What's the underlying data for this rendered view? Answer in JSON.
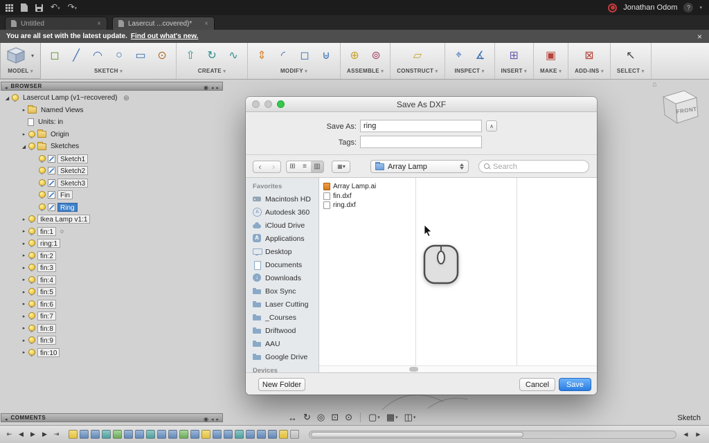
{
  "titlebar": {
    "user": "Jonathan Odom"
  },
  "tabs": [
    {
      "label": "Untitled",
      "active": false
    },
    {
      "label": "Lasercut ...covered)*",
      "active": true
    }
  ],
  "notification": {
    "message": "You are all set with the latest update.",
    "link": "Find out what's new.",
    "close": "×"
  },
  "ribbon": {
    "groups": [
      {
        "label": "MODEL",
        "model": true,
        "icons": [
          "model-cube"
        ]
      },
      {
        "label": "SKETCH",
        "icons": [
          "create-sketch",
          "sketch-line",
          "sketch-arc",
          "sketch-circle",
          "sketch-rect",
          "sketch-offset"
        ]
      },
      {
        "label": "CREATE",
        "icons": [
          "extrude",
          "revolve",
          "sweep"
        ]
      },
      {
        "label": "MODIFY",
        "icons": [
          "press-pull",
          "fillet",
          "shell",
          "combine"
        ]
      },
      {
        "label": "ASSEMBLE",
        "icons": [
          "new-component",
          "joint"
        ]
      },
      {
        "label": "CONSTRUCT",
        "icons": [
          "construct-plane"
        ]
      },
      {
        "label": "INSPECT",
        "icons": [
          "measure",
          "section-analysis"
        ]
      },
      {
        "label": "INSERT",
        "icons": [
          "insert-mesh"
        ]
      },
      {
        "label": "MAKE",
        "icons": [
          "make-3d-print"
        ]
      },
      {
        "label": "ADD-INS",
        "icons": [
          "scripts-addins"
        ]
      },
      {
        "label": "SELECT",
        "icons": [
          "select-cursor"
        ]
      }
    ]
  },
  "browser": {
    "title": "BROWSER",
    "rows": [
      {
        "label": "Lasercut Lamp (v1~recovered)",
        "indent": 0,
        "arrow": "open",
        "bulb": true,
        "trailing": "target"
      },
      {
        "label": "Named Views",
        "indent": 1,
        "arrow": "closed",
        "folder": true
      },
      {
        "label": "Units: in",
        "indent": 1,
        "doc": true
      },
      {
        "label": "Origin",
        "indent": 1,
        "arrow": "closed",
        "bulb": true,
        "folder": true
      },
      {
        "label": "Sketches",
        "indent": 1,
        "arrow": "open",
        "bulb": true,
        "folder": true
      },
      {
        "label": "Sketch1",
        "indent": 2,
        "bulb": true,
        "sketch": true,
        "chip": true
      },
      {
        "label": "Sketch2",
        "indent": 2,
        "bulb": true,
        "sketch": true,
        "chip": true
      },
      {
        "label": "Sketch3",
        "indent": 2,
        "bulb": true,
        "sketch": true,
        "chip": true
      },
      {
        "label": "Fin",
        "indent": 2,
        "bulb": true,
        "sketch": true,
        "chip": true
      },
      {
        "label": "Ring",
        "indent": 2,
        "bulb": true,
        "sketch": true,
        "chip": true,
        "selected": true
      },
      {
        "label": "Ikea Lamp v1:1",
        "indent": 1,
        "arrow": "closed",
        "bulb": true,
        "chip": true
      },
      {
        "label": "fin:1",
        "indent": 1,
        "arrow": "closed",
        "bulb": true,
        "chip": true,
        "trailing": "circle"
      },
      {
        "label": "ring:1",
        "indent": 1,
        "arrow": "closed",
        "bulb": true,
        "chip": true
      },
      {
        "label": "fin:2",
        "indent": 1,
        "arrow": "closed",
        "bulb": true,
        "chip": true
      },
      {
        "label": "fin:3",
        "indent": 1,
        "arrow": "closed",
        "bulb": true,
        "chip": true
      },
      {
        "label": "fin:4",
        "indent": 1,
        "arrow": "closed",
        "bulb": true,
        "chip": true
      },
      {
        "label": "fin:5",
        "indent": 1,
        "arrow": "closed",
        "bulb": true,
        "chip": true
      },
      {
        "label": "fin:6",
        "indent": 1,
        "arrow": "closed",
        "bulb": true,
        "chip": true
      },
      {
        "label": "fin:7",
        "indent": 1,
        "arrow": "closed",
        "bulb": true,
        "chip": true
      },
      {
        "label": "fin:8",
        "indent": 1,
        "arrow": "closed",
        "bulb": true,
        "chip": true
      },
      {
        "label": "fin:9",
        "indent": 1,
        "arrow": "closed",
        "bulb": true,
        "chip": true
      },
      {
        "label": "fin:10",
        "indent": 1,
        "arrow": "closed",
        "bulb": true,
        "chip": true
      }
    ]
  },
  "viewcube": {
    "face": "FRONT"
  },
  "dialog": {
    "title": "Save As DXF",
    "save_as_label": "Save As:",
    "save_as_value": "ring",
    "tags_label": "Tags:",
    "tags_value": "",
    "location_value": "Array Lamp",
    "search_placeholder": "Search",
    "favorites_title": "Favorites",
    "devices_title": "Devices",
    "favorites": [
      {
        "label": "Macintosh HD",
        "icon": "hard-drive"
      },
      {
        "label": "Autodesk 360",
        "icon": "autodesk-360"
      },
      {
        "label": "iCloud Drive",
        "icon": "icloud"
      },
      {
        "label": "Applications",
        "icon": "applications"
      },
      {
        "label": "Desktop",
        "icon": "desktop"
      },
      {
        "label": "Documents",
        "icon": "documents"
      },
      {
        "label": "Downloads",
        "icon": "downloads"
      },
      {
        "label": "Box Sync",
        "icon": "folder"
      },
      {
        "label": "Laser Cutting",
        "icon": "folder"
      },
      {
        "label": "_Courses",
        "icon": "folder"
      },
      {
        "label": "Driftwood",
        "icon": "folder"
      },
      {
        "label": "AAU",
        "icon": "folder"
      },
      {
        "label": "Google Drive",
        "icon": "folder"
      }
    ],
    "files": [
      {
        "name": "Array Lamp.ai",
        "icon": "ai-file"
      },
      {
        "name": "fin.dxf",
        "icon": "dxf-file"
      },
      {
        "name": "ring.dxf",
        "icon": "dxf-file"
      }
    ],
    "new_folder_label": "New Folder",
    "cancel_label": "Cancel",
    "save_label": "Save"
  },
  "comments": {
    "title": "COMMENTS"
  },
  "viewbar": {
    "items": [
      {
        "name": "pan"
      },
      {
        "name": "orbit"
      },
      {
        "name": "look-at"
      },
      {
        "name": "zoom-window"
      },
      {
        "name": "zoom"
      },
      {
        "name": "display-settings",
        "dropdown": true
      },
      {
        "name": "grid-and-snaps",
        "dropdown": true
      },
      {
        "name": "viewports",
        "dropdown": true
      }
    ]
  },
  "statusbar": {
    "mode": "Sketch"
  },
  "timeline": {
    "controls": [
      "go-to-start",
      "step-back",
      "play",
      "step-forward",
      "go-to-end"
    ],
    "features": [
      "yellow",
      "blue",
      "blue",
      "teal",
      "green",
      "blue",
      "blue",
      "teal",
      "blue",
      "blue",
      "green",
      "blue",
      "yellow",
      "blue",
      "blue",
      "teal",
      "blue",
      "blue",
      "blue",
      "yellow",
      "gray"
    ]
  }
}
